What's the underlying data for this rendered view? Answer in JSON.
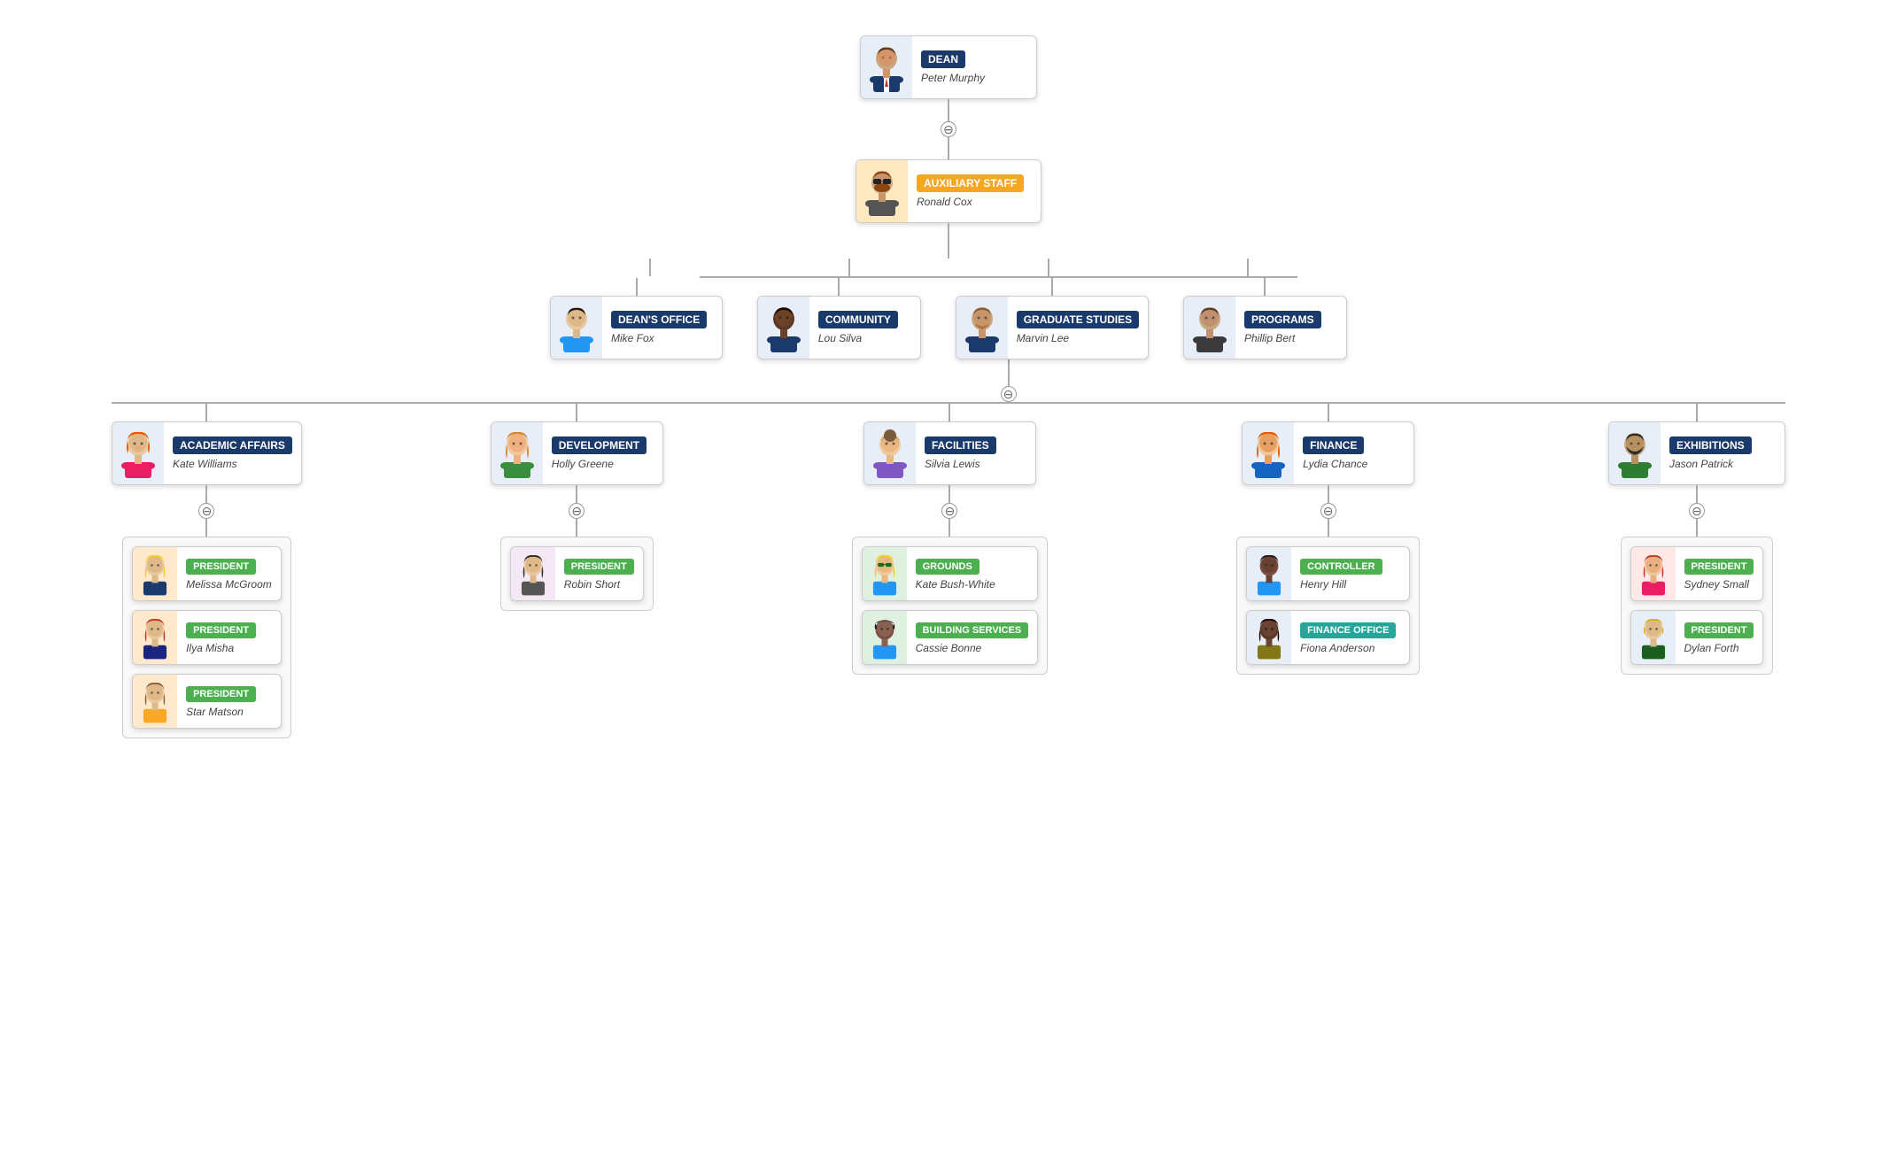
{
  "nodes": {
    "dean": {
      "title": "DEAN",
      "name": "Peter Murphy",
      "titleClass": "title-blue",
      "avatarType": "man-suit"
    },
    "auxiliary": {
      "title": "AUXILIARY STAFF",
      "name": "Ronald Cox",
      "titleClass": "title-orange",
      "avatarType": "man-sunglasses"
    },
    "deans_office": {
      "title": "DEAN'S OFFICE",
      "name": "Mike Fox",
      "titleClass": "title-blue",
      "avatarType": "man-dark"
    },
    "community": {
      "title": "COMMUNITY",
      "name": "Lou Silva",
      "titleClass": "title-blue",
      "avatarType": "man-black"
    },
    "graduate": {
      "title": "GRADUATE STUDIES",
      "name": "Marvin Lee",
      "titleClass": "title-blue",
      "avatarType": "man-beard"
    },
    "programs": {
      "title": "PROGRAMS",
      "name": "Phillip Bert",
      "titleClass": "title-blue",
      "avatarType": "man-dark2"
    },
    "academic": {
      "title": "ACADEMIC AFFAIRS",
      "name": "Kate Williams",
      "titleClass": "title-blue",
      "avatarType": "woman-red"
    },
    "development": {
      "title": "DEVELOPMENT",
      "name": "Holly Greene",
      "titleClass": "title-blue",
      "avatarType": "woman-peach"
    },
    "facilities": {
      "title": "FACILITIES",
      "name": "Silvia Lewis",
      "titleClass": "title-blue",
      "avatarType": "woman-bun"
    },
    "finance": {
      "title": "FINANCE",
      "name": "Lydia Chance",
      "titleClass": "title-blue",
      "avatarType": "woman-orange"
    },
    "exhibitions": {
      "title": "EXHIBITIONS",
      "name": "Jason Patrick",
      "titleClass": "title-blue",
      "avatarType": "man-beard2"
    },
    "president_melissa": {
      "title": "PRESIDENT",
      "name": "Melissa McGroom",
      "titleClass": "title-green",
      "avatarType": "woman-yellow"
    },
    "president_ilya": {
      "title": "PRESIDENT",
      "name": "Ilya Misha",
      "titleClass": "title-green",
      "avatarType": "woman-redhead"
    },
    "president_star": {
      "title": "PRESIDENT",
      "name": "Star Matson",
      "titleClass": "title-green",
      "avatarType": "woman-brown"
    },
    "president_robin": {
      "title": "PRESIDENT",
      "name": "Robin Short",
      "titleClass": "title-green",
      "avatarType": "woman-dark"
    },
    "grounds": {
      "title": "GROUNDS",
      "name": "Kate Bush-White",
      "titleClass": "title-green",
      "avatarType": "woman-glasses"
    },
    "building": {
      "title": "BUILDING SERVICES",
      "name": "Cassie Bonne",
      "titleClass": "title-green",
      "avatarType": "woman-dark2"
    },
    "controller": {
      "title": "CONTROLLER",
      "name": "Henry Hill",
      "titleClass": "title-green",
      "avatarType": "woman-dark3"
    },
    "finance_office": {
      "title": "FINANCE OFFICE",
      "name": "Fiona Anderson",
      "titleClass": "title-teal",
      "avatarType": "woman-dark4"
    },
    "president_sydney": {
      "title": "PRESIDENT",
      "name": "Sydney Small",
      "titleClass": "title-green",
      "avatarType": "woman-redhead2"
    },
    "president_dylan": {
      "title": "PRESIDENT",
      "name": "Dylan Forth",
      "titleClass": "title-green",
      "avatarType": "man-blonde"
    }
  },
  "collapse_symbol": "⊖"
}
